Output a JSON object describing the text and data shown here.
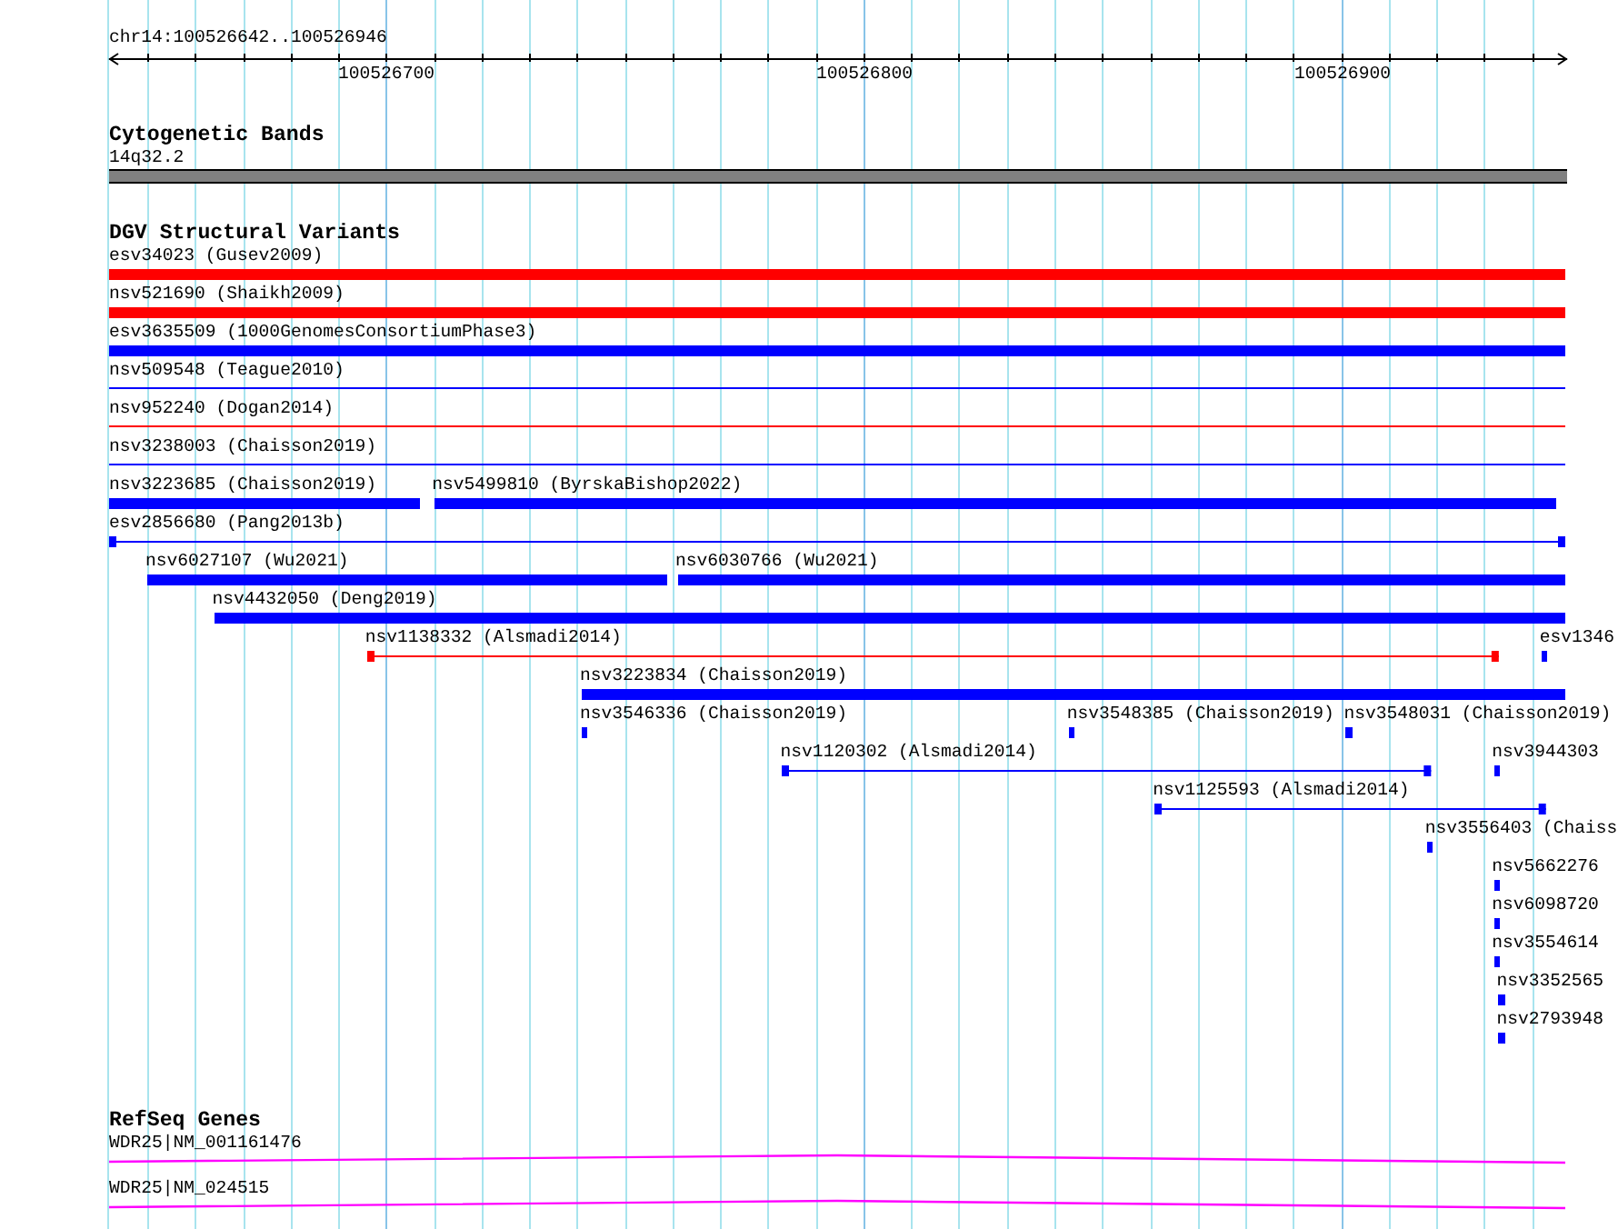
{
  "ruler": {
    "location": "chr14:100526642..100526946",
    "tick_labels": [
      "100526700",
      "100526800",
      "100526900"
    ]
  },
  "tracks": [
    {
      "kind": "bands",
      "title": "Cytogenetic Bands",
      "rows": [
        [
          {
            "kind": "band",
            "label": "14q32.2"
          }
        ]
      ]
    },
    {
      "kind": "variants",
      "title": "DGV Structural Variants",
      "rows": [
        [
          {
            "kind": "thick",
            "label": "esv34023 (Gusev2009)",
            "color": "#ff0000"
          }
        ],
        [
          {
            "kind": "thick",
            "label": "nsv521690 (Shaikh2009)",
            "color": "#ff0000"
          }
        ],
        [
          {
            "kind": "thick",
            "label": "esv3635509 (1000GenomesConsortiumPhase3)",
            "color": "#0000ff"
          }
        ],
        [
          {
            "kind": "thin",
            "label": "nsv509548 (Teague2010)",
            "color": "#0000ff"
          }
        ],
        [
          {
            "kind": "thin",
            "label": "nsv952240 (Dogan2014)",
            "color": "#ff0000"
          }
        ],
        [
          {
            "kind": "thin",
            "label": "nsv3238003 (Chaisson2019)",
            "color": "#0000ff"
          }
        ],
        [
          {
            "kind": "thick",
            "label": "nsv3223685 (Chaisson2019)",
            "color": "#0000ff"
          },
          {
            "kind": "thick",
            "label": "nsv5499810 (ByrskaBishop2022)",
            "color": "#0000ff"
          }
        ],
        [
          {
            "kind": "linked",
            "label": "esv2856680 (Pang2013b)",
            "color": "#0000ff"
          }
        ],
        [
          {
            "kind": "thick",
            "label": "nsv6027107 (Wu2021)",
            "color": "#0000ff"
          },
          {
            "kind": "thick",
            "label": "nsv6030766 (Wu2021)",
            "color": "#0000ff"
          }
        ],
        [
          {
            "kind": "thick",
            "label": "nsv4432050 (Deng2019)",
            "color": "#0000ff"
          }
        ],
        [
          {
            "kind": "linked",
            "label": "nsv1138332 (Alsmadi2014)",
            "color": "#ff0000"
          },
          {
            "kind": "thick",
            "label": "esv1346",
            "color": "#0000ff"
          }
        ],
        [
          {
            "kind": "thick",
            "label": "nsv3223834 (Chaisson2019)",
            "color": "#0000ff"
          }
        ],
        [
          {
            "kind": "thick",
            "label": "nsv3546336 (Chaisson2019)",
            "color": "#0000ff"
          },
          {
            "kind": "thick",
            "label": "nsv3548385 (Chaisson2019)",
            "color": "#0000ff"
          },
          {
            "kind": "thick",
            "label": "nsv3548031 (Chaisson2019)",
            "color": "#0000ff"
          }
        ],
        [
          {
            "kind": "linked",
            "label": "nsv1120302 (Alsmadi2014)",
            "color": "#0000ff"
          },
          {
            "kind": "thick",
            "label": "nsv3944303",
            "color": "#0000ff"
          }
        ],
        [
          {
            "kind": "linked",
            "label": "nsv1125593 (Alsmadi2014)",
            "color": "#0000ff"
          }
        ],
        [
          {
            "kind": "thick",
            "label": "nsv3556403 (Chaiss",
            "color": "#0000ff"
          }
        ],
        [
          {
            "kind": "thick",
            "label": "nsv5662276",
            "color": "#0000ff"
          }
        ],
        [
          {
            "kind": "thick",
            "label": "nsv6098720",
            "color": "#0000ff"
          }
        ],
        [
          {
            "kind": "thick",
            "label": "nsv3554614",
            "color": "#0000ff"
          }
        ],
        [
          {
            "kind": "thick",
            "label": "nsv3352565",
            "color": "#0000ff"
          }
        ],
        [
          {
            "kind": "thick",
            "label": "nsv2793948",
            "color": "#0000ff"
          }
        ]
      ]
    },
    {
      "kind": "genes",
      "title": "RefSeq Genes",
      "rows": [
        [
          {
            "kind": "intron",
            "label": "WDR25|NM_001161476"
          }
        ],
        [
          {
            "kind": "intron",
            "label": "WDR25|NM_024515"
          }
        ]
      ]
    }
  ]
}
